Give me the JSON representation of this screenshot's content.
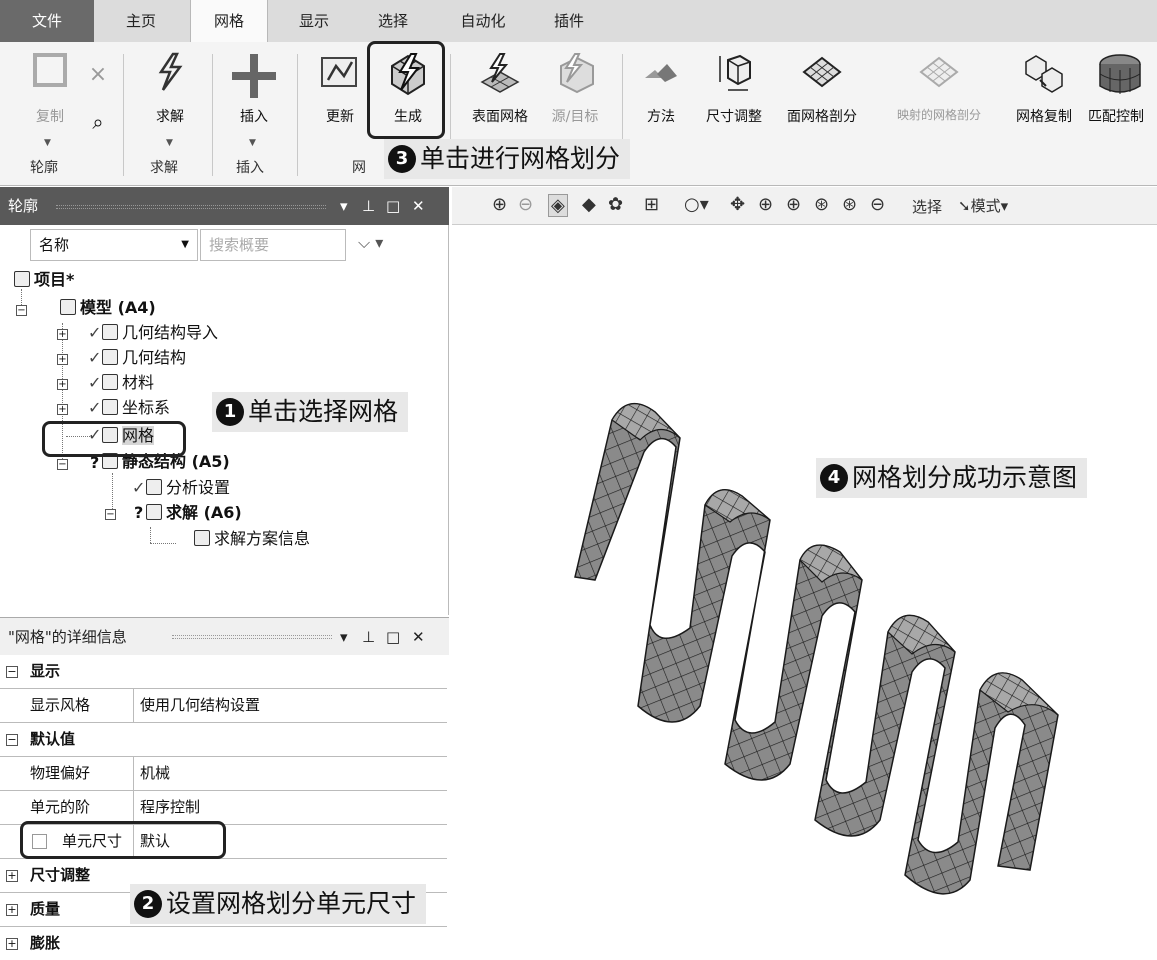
{
  "tabs": [
    "文件",
    "主页",
    "网格",
    "显示",
    "选择",
    "自动化",
    "插件"
  ],
  "ribbon": {
    "copy": "复制",
    "solve": "求解",
    "insert": "插入",
    "update": "更新",
    "generate": "生成",
    "surface_mesh": "表面网格",
    "source_target": "源/目标",
    "method": "方法",
    "sizing": "尺寸调整",
    "face_meshing": "面网格剖分",
    "mapped_face_meshing": "映射的网格剖分",
    "mesh_copy": "网格复制",
    "match_control": "匹配控制",
    "group_outline": "轮廓",
    "group_solve": "求解",
    "group_insert": "插入",
    "group_mesh": "网"
  },
  "outline": {
    "title": "轮廓",
    "filter_label": "名称",
    "search_placeholder": "搜索概要",
    "items": {
      "project": "项目*",
      "model": "模型 (A4)",
      "geometry_import": "几何结构导入",
      "geometry": "几何结构",
      "materials": "材料",
      "coordinate_systems": "坐标系",
      "mesh": "网格",
      "static_structural": "静态结构 (A5)",
      "analysis_settings": "分析设置",
      "solution": "求解 (A6)",
      "solution_info": "求解方案信息"
    }
  },
  "details": {
    "title": "\"网格\"的详细信息",
    "rows": {
      "cat_display": "显示",
      "display_style_key": "显示风格",
      "display_style_val": "使用几何结构设置",
      "cat_defaults": "默认值",
      "physics_pref_key": "物理偏好",
      "physics_pref_val": "机械",
      "element_order_key": "单元的阶",
      "element_order_val": "程序控制",
      "element_size_key": "单元尺寸",
      "element_size_val": "默认",
      "cat_sizing": "尺寸调整",
      "cat_quality": "质量",
      "cat_inflation": "膨胀"
    }
  },
  "graphics_toolbar": {
    "select": "选择",
    "mode": "模式"
  },
  "callouts": {
    "c1": {
      "num": "1",
      "text": "单击选择网格"
    },
    "c2": {
      "num": "2",
      "text": "设置网格划分单元尺寸"
    },
    "c3": {
      "num": "3",
      "text": "单击进行网格划分"
    },
    "c4": {
      "num": "4",
      "text": "网格划分成功示意图"
    }
  },
  "colors": {
    "title_bar": "#595959",
    "ribbon": "#f4f4f4",
    "mesh_face": "#8a8a8a",
    "mesh_edge": "#222222"
  }
}
